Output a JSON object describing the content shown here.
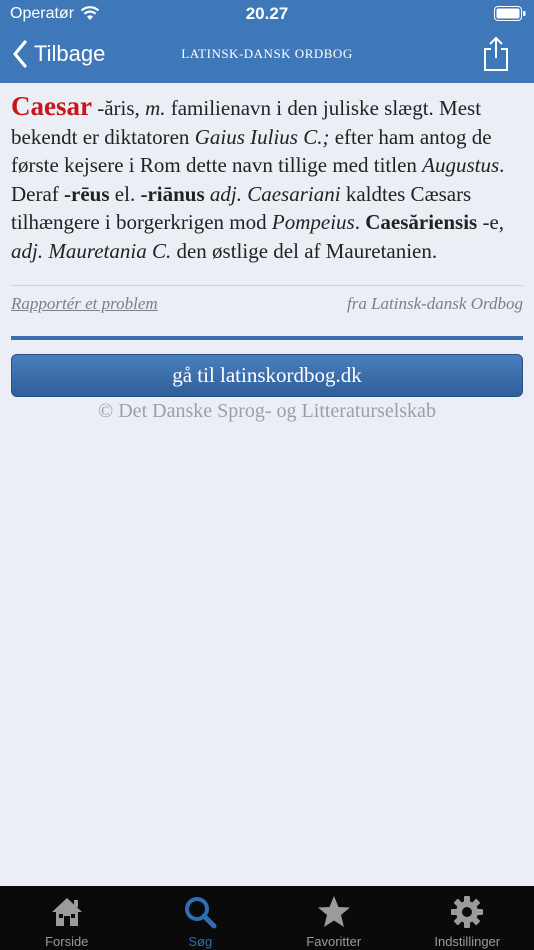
{
  "status_bar": {
    "carrier": "Operatør",
    "time": "20.27"
  },
  "nav": {
    "back_label": "Tilbage",
    "title": "LATINSK-DANSK ORDBOG"
  },
  "entry": {
    "headword": "Caesar",
    "t1": " -ăris, ",
    "t2": "m.",
    "t3": " familienavn i den juliske slægt. Mest bekendt er diktatoren ",
    "t4": "Gaius Iulius C.;",
    "t5": " efter ham antog de første kejsere i Rom dette navn tillige med titlen ",
    "t6": "Augustus",
    "t7": ". Deraf ",
    "t8": "-rēus",
    "t9": " el. ",
    "t10": "-riānus",
    "t11": " ",
    "t12": "adj.",
    "t13": " ",
    "t14": "Caesariani",
    "t15": " kaldtes Cæsars tilhængere i borgerkrigen mod ",
    "t16": "Pompeius",
    "t17": ". ",
    "t18": "Caesăriensis",
    "t19": " -e, ",
    "t20": "adj. Mauretania C.",
    "t21": " den østlige del af Mauretanien."
  },
  "meta": {
    "report_label": "Rapportér et problem",
    "source_label": "fra Latinsk-dansk Ordbog"
  },
  "goto_button_label": "gå til latinskordbog.dk",
  "copyright": "© Det Danske Sprog- og Litteraturselskab",
  "tabs": [
    {
      "label": "Forside",
      "icon": "house-icon",
      "active": false
    },
    {
      "label": "Søg",
      "icon": "search-icon",
      "active": true
    },
    {
      "label": "Favoritter",
      "icon": "star-icon",
      "active": false
    },
    {
      "label": "Indstillinger",
      "icon": "gear-icon",
      "active": false
    }
  ],
  "colors": {
    "nav_blue": "#3f78b9",
    "headword_red": "#c8141a",
    "active_tab": "#2f6eb5"
  }
}
